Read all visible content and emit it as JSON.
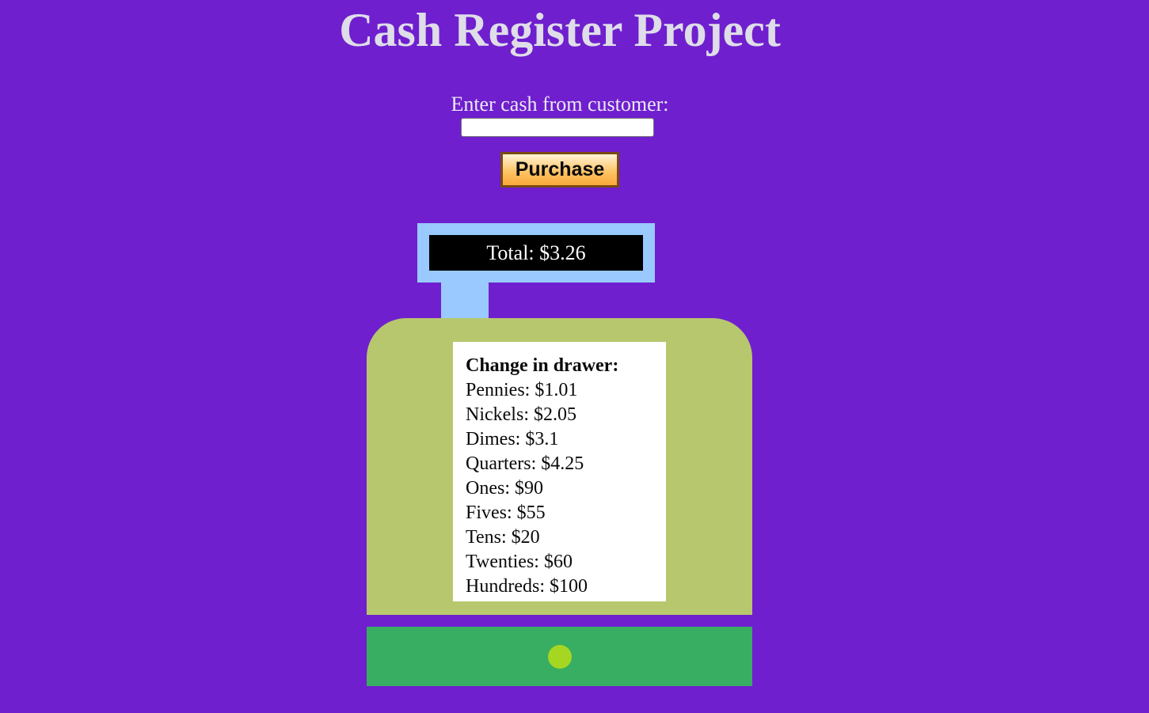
{
  "header": {
    "title": "Cash Register Project"
  },
  "form": {
    "cash_label": "Enter cash from customer:",
    "cash_value": "",
    "purchase_label": "Purchase"
  },
  "display": {
    "total_text": "Total: $3.26"
  },
  "drawer": {
    "heading": "Change in drawer:",
    "items": [
      {
        "label": "Pennies: $1.01"
      },
      {
        "label": "Nickels: $2.05"
      },
      {
        "label": "Dimes: $3.1"
      },
      {
        "label": "Quarters: $4.25"
      },
      {
        "label": "Ones: $90"
      },
      {
        "label": "Fives: $55"
      },
      {
        "label": "Tens: $20"
      },
      {
        "label": "Twenties: $60"
      },
      {
        "label": "Hundreds: $100"
      }
    ]
  },
  "colors": {
    "background": "#6f1fce",
    "display_frame": "#99c9ff",
    "register_body": "#b7c76d",
    "cash_drawer": "#37ae61",
    "drawer_knob": "#a5d622"
  }
}
